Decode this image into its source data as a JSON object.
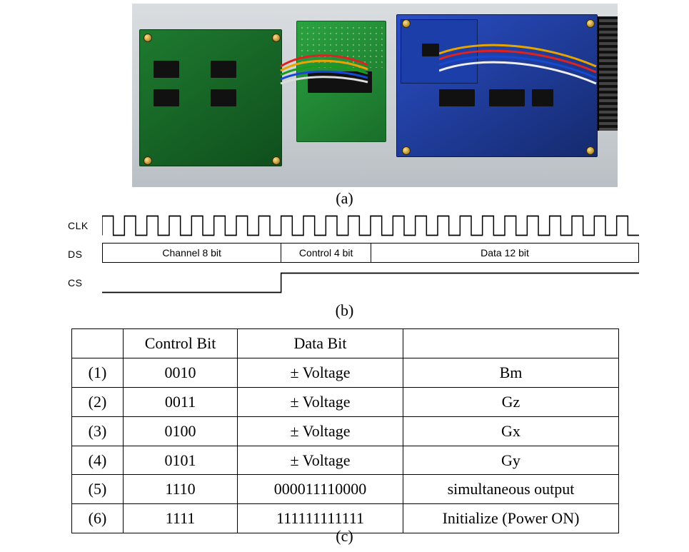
{
  "figure": {
    "image_caption": "(a)",
    "timing_caption": "(b)",
    "table_caption": "(c)"
  },
  "timing": {
    "clk_label": "CLK",
    "ds_label": "DS",
    "cs_label": "CS",
    "segments": {
      "channel": "Channel 8 bit",
      "control": "Control 4 bit",
      "data": "Data 12 bit"
    }
  },
  "table": {
    "headers": {
      "idx": "",
      "control": "Control Bit",
      "data": "Data Bit",
      "desc": ""
    },
    "rows": [
      {
        "idx": "(1)",
        "control": "0010",
        "data": "± Voltage",
        "desc": "Bm"
      },
      {
        "idx": "(2)",
        "control": "0011",
        "data": "± Voltage",
        "desc": "Gz"
      },
      {
        "idx": "(3)",
        "control": "0100",
        "data": "± Voltage",
        "desc": "Gx"
      },
      {
        "idx": "(4)",
        "control": "0101",
        "data": "± Voltage",
        "desc": "Gy"
      },
      {
        "idx": "(5)",
        "control": "1110",
        "data": "000011110000",
        "desc": "simultaneous output"
      },
      {
        "idx": "(6)",
        "control": "1111",
        "data": "111111111111",
        "desc": "Initialize (Power ON)"
      }
    ]
  }
}
